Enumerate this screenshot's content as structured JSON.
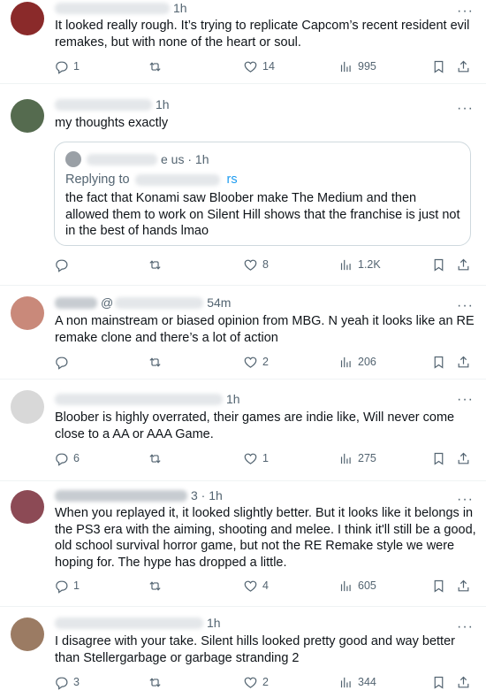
{
  "posts": [
    {
      "time": "1h",
      "avatar_color": "#8a2a2a",
      "text": "It looked really rough. It’s trying to replicate Capcom’s recent resident evil remakes, but with none of the heart or soul.",
      "replies": "1",
      "reposts": "",
      "likes": "14",
      "views": "995"
    },
    {
      "time": "1h",
      "avatar_color": "#556b4f",
      "text": "my thoughts exactly",
      "quote": {
        "handle_fragment": "e us",
        "time": "1h",
        "replying_to_label": "Replying to",
        "replying_to_fragment": "rs",
        "text": "the fact that Konami saw Bloober make The Medium and then allowed them to work on Silent Hill shows that the franchise is just not in the best of hands lmao"
      },
      "replies": "",
      "reposts": "",
      "likes": "8",
      "views": "1.2K"
    },
    {
      "time": "54m",
      "handle_fragment": "@",
      "avatar_color": "#c9897a",
      "text": "A non mainstream or biased opinion from MBG. N yeah it looks like an RE remake clone and there’s a lot of action",
      "replies": "",
      "reposts": "",
      "likes": "2",
      "views": "206"
    },
    {
      "time": "1h",
      "avatar_color": "#d8d8d8",
      "text": "Bloober is highly overrated, their games are indie like, Will never come close to a AA or AAA Game.",
      "replies": "6",
      "reposts": "",
      "likes": "1",
      "views": "275"
    },
    {
      "time": "1h",
      "handle_fragment": "3",
      "avatar_color": "#8c4a55",
      "text": "When you replayed it, it looked slightly better.  But it looks like it belongs in the PS3 era with the aiming, shooting and melee.  I think it'll still be a good, old school survival horror game, but not the RE Remake style we were hoping for.  The hype has dropped a little.",
      "replies": "1",
      "reposts": "",
      "likes": "4",
      "views": "605"
    },
    {
      "time": "1h",
      "avatar_color": "#9b7b63",
      "text": "I disagree with your take. Silent hills looked pretty good and way better than Stellergarbage or garbage stranding 2",
      "replies": "3",
      "reposts": "",
      "likes": "2",
      "views": "344"
    }
  ],
  "colors": {
    "muted": "#536471",
    "link": "#1d9bf0",
    "border": "#eff3f4"
  },
  "icons": [
    "reply-icon",
    "repost-icon",
    "like-icon",
    "views-icon",
    "bookmark-icon",
    "share-icon",
    "more-icon"
  ]
}
